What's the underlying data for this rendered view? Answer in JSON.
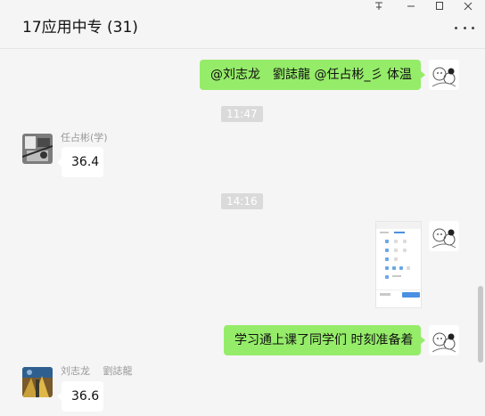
{
  "window": {
    "title": "17应用中专 (31)",
    "controls": [
      "pin-icon",
      "minimize-icon",
      "maximize-icon",
      "close-icon"
    ],
    "more_icon": "more-icon"
  },
  "colors": {
    "own_bubble": "#95ec69",
    "other_bubble": "#ffffff",
    "background": "#f5f5f5",
    "timestamp_bg": "#dadada",
    "sender_name": "#999999"
  },
  "messages": [
    {
      "type": "text",
      "side": "self",
      "text": "@刘志龙　劉誌龍 @任占彬_彡 体温"
    },
    {
      "type": "time",
      "text": "11:47"
    },
    {
      "type": "text",
      "side": "other",
      "sender": "任占彬(学)",
      "text": "36.4"
    },
    {
      "type": "time",
      "text": "14:16"
    },
    {
      "type": "image",
      "side": "self"
    },
    {
      "type": "text",
      "side": "self",
      "text": "学习通上课了同学们 时刻准备着"
    },
    {
      "type": "text",
      "side": "other",
      "sender": "刘志龙　 劉誌龍",
      "text": "36.6"
    }
  ]
}
